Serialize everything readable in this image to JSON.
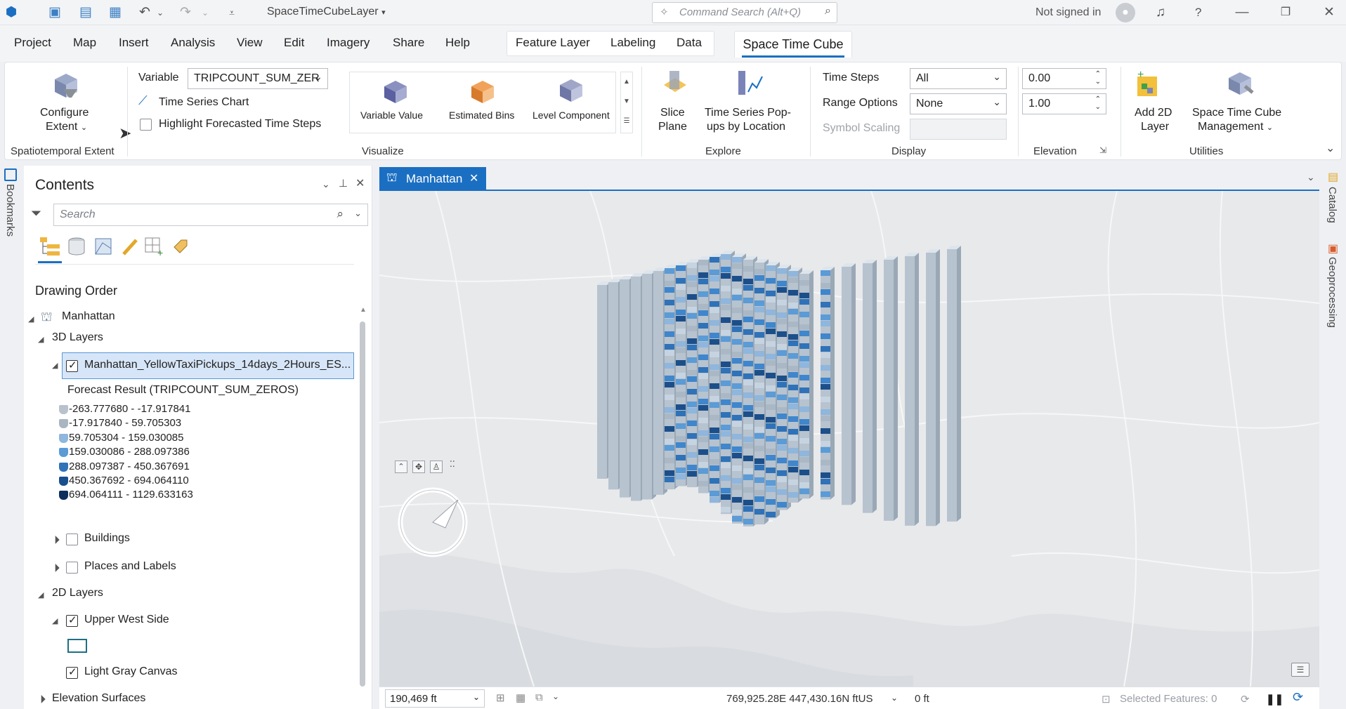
{
  "titlebar": {
    "project_title": "SpaceTimeCubeLayer",
    "command_search_placeholder": "Command Search (Alt+Q)",
    "signin_text": "Not signed in",
    "help": "?"
  },
  "menu": [
    "Project",
    "Map",
    "Insert",
    "Analysis",
    "View",
    "Edit",
    "Imagery",
    "Share",
    "Help"
  ],
  "contextual_tabs": [
    "Feature Layer",
    "Labeling",
    "Data"
  ],
  "active_tab": "Space Time Cube",
  "ribbon": {
    "configure_extent": [
      "Configure",
      "Extent"
    ],
    "spatiotemporal_group": "Spatiotemporal Extent",
    "variable_label": "Variable",
    "variable_value": "TRIPCOUNT_SUM_ZER",
    "time_series_chart": "Time Series Chart",
    "highlight_forecasted": "Highlight Forecasted Time Steps",
    "gallery": [
      "Variable Value",
      "Estimated Bins",
      "Level Component"
    ],
    "visualize_group": "Visualize",
    "slice_plane": [
      "Slice",
      "Plane"
    ],
    "time_series_popups": [
      "Time Series Pop-",
      "ups by Location"
    ],
    "explore_group": "Explore",
    "time_steps_label": "Time Steps",
    "time_steps_value": "All",
    "range_options_label": "Range Options",
    "range_options_value": "None",
    "symbol_scaling_label": "Symbol Scaling",
    "display_group": "Display",
    "elevation_1": "0.00",
    "elevation_2": "1.00",
    "elevation_group": "Elevation",
    "add_2d_layer": [
      "Add 2D",
      "Layer"
    ],
    "stc_management": [
      "Space Time Cube",
      "Management"
    ],
    "utilities_group": "Utilities"
  },
  "side_tabs": {
    "left": "Bookmarks",
    "right_1": "Catalog",
    "right_2": "Geoprocessing"
  },
  "contents": {
    "title": "Contents",
    "search_placeholder": "Search",
    "drawing_order": "Drawing Order",
    "map_name": "Manhattan",
    "layers_3d": "3D Layers",
    "selected_layer": "Manhattan_YellowTaxiPickups_14days_2Hours_ES...",
    "forecast_heading": "Forecast Result (TRIPCOUNT_SUM_ZEROS)",
    "legend": [
      {
        "label": "-263.777680 - -17.917841",
        "color": "#b9c2cc"
      },
      {
        "label": "-17.917840 - 59.705303",
        "color": "#aab5c2"
      },
      {
        "label": "59.705304 - 159.030085",
        "color": "#8fb6dc"
      },
      {
        "label": "159.030086 - 288.097386",
        "color": "#5b9bd6"
      },
      {
        "label": "288.097387 - 450.367691",
        "color": "#2f72b8"
      },
      {
        "label": "450.367692 - 694.064110",
        "color": "#1a4f8e"
      },
      {
        "label": "694.064111 - 1129.633163",
        "color": "#0f2f5c"
      }
    ],
    "buildings": "Buildings",
    "places_labels": "Places and Labels",
    "layers_2d": "2D Layers",
    "upper_west_side": "Upper West Side",
    "light_gray_canvas": "Light Gray Canvas",
    "elevation_surfaces": "Elevation Surfaces"
  },
  "map": {
    "tab_name": "Manhattan",
    "scale": "190,469 ft",
    "coordinates": "769,925.28E 447,430.16N ftUS",
    "elevation": "0 ft",
    "selected_features": "Selected Features: 0"
  },
  "colors": {
    "accent": "#1b6fc2",
    "bar_light": "#b7c3cf",
    "bar_blue": "#3f86cc",
    "bar_dark": "#1c4f8a"
  }
}
